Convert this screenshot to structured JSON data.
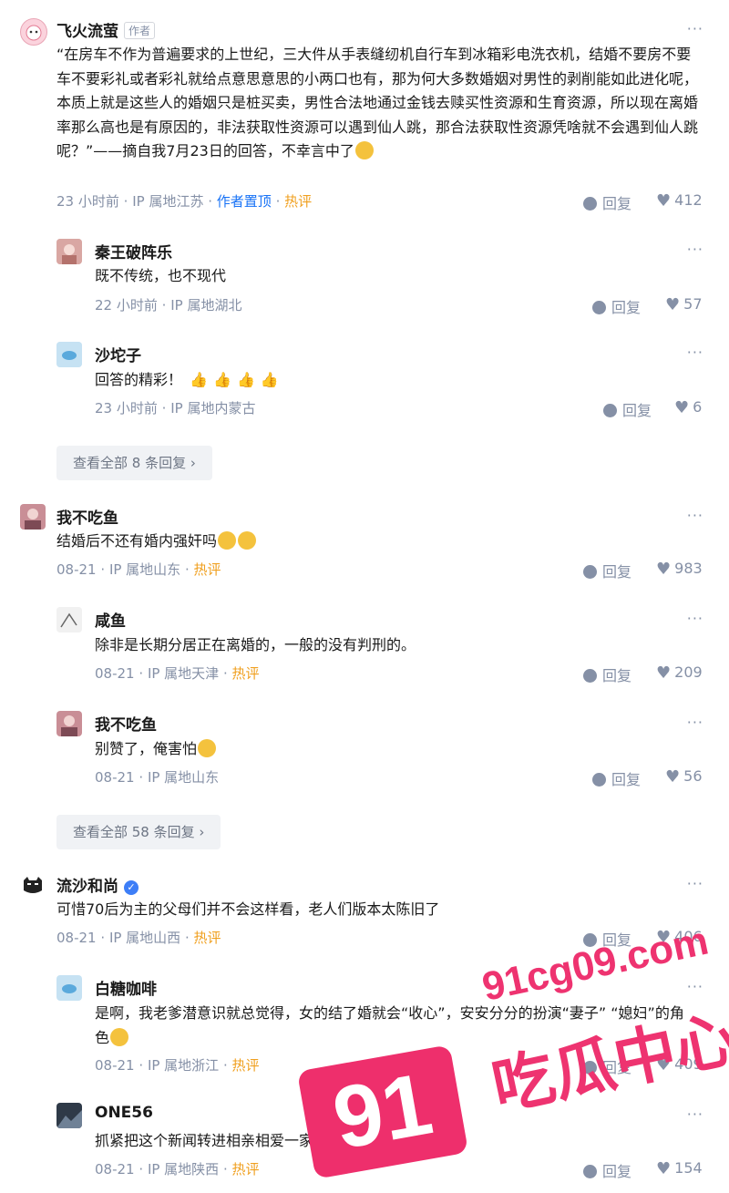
{
  "comments": [
    {
      "author": "飞火流萤",
      "tag": "作者",
      "text": "“在房车不作为普遍要求的上世纪，三大件从手表缝纫机自行车到冰箱彩电洗衣机，结婚不要房不要车不要彩礼或者彩礼就给点意思意思的小两口也有，那为何大多数婚姻对男性的剥削能如此进化呢，本质上就是这些人的婚姻只是桩买卖，男性合法地通过金钱去赎买性资源和生育资源，所以现在离婚率那么高也是有原因的，非法获取性资源可以遇到仙人跳，那合法获取性资源凭啥就不会遇到仙人跳呢？”——摘自我7月23日的回答，不幸言中了",
      "time": "23 小时前",
      "ip": "IP 属地江苏",
      "pinned": "作者置顶",
      "hot": "热评",
      "reply": "回复",
      "likes": "412",
      "replies": [
        {
          "author": "秦王破阵乐",
          "text": "既不传统，也不现代",
          "time": "22 小时前",
          "ip": "IP 属地湖北",
          "reply": "回复",
          "likes": "57"
        },
        {
          "author": "沙坨子",
          "text": "回答的精彩！",
          "time": "23 小时前",
          "ip": "IP 属地内蒙古",
          "reply": "回复",
          "likes": "6"
        }
      ],
      "view_all": "查看全部 8 条回复"
    },
    {
      "author": "我不吃鱼",
      "text": "结婚后不还有婚内强奸吗",
      "time": "08-21",
      "ip": "IP 属地山东",
      "hot": "热评",
      "reply": "回复",
      "likes": "983",
      "replies": [
        {
          "author": "咸鱼",
          "text": "除非是长期分居正在离婚的，一般的没有判刑的。",
          "time": "08-21",
          "ip": "IP 属地天津",
          "hot": "热评",
          "reply": "回复",
          "likes": "209"
        },
        {
          "author": "我不吃鱼",
          "text": "别赞了，俺害怕",
          "time": "08-21",
          "ip": "IP 属地山东",
          "reply": "回复",
          "likes": "56"
        }
      ],
      "view_all": "查看全部 58 条回复"
    },
    {
      "author": "流沙和尚",
      "text": "可惜70后为主的父母们并不会这样看，老人们版本太陈旧了",
      "time": "08-21",
      "ip": "IP 属地山西",
      "hot": "热评",
      "reply": "回复",
      "likes": "406",
      "replies": [
        {
          "author": "白糖咖啡",
          "text": "是啊，我老爹潜意识就总觉得，女的结了婚就会“收心”，安安分分的扮演“妻子” “媳妇”的角色",
          "time": "08-21",
          "ip": "IP 属地浙江",
          "hot": "热评",
          "reply": "回复",
          "likes": "409"
        },
        {
          "author": "ONE56",
          "text": "抓紧把这个新闻转进相亲相爱一家人群里",
          "time": "08-21",
          "ip": "IP 属地陕西",
          "hot": "热评",
          "reply": "回复",
          "likes": "154"
        }
      ]
    }
  ],
  "more_label": "···",
  "sep": "·",
  "watermark": {
    "url": "91cg09.com",
    "badge": "91",
    "name": "吃瓜中心"
  },
  "colors": {
    "accent": "#1772f6",
    "hot": "#f0a020",
    "meta": "#8590a6",
    "watermark": "#ee3370"
  }
}
